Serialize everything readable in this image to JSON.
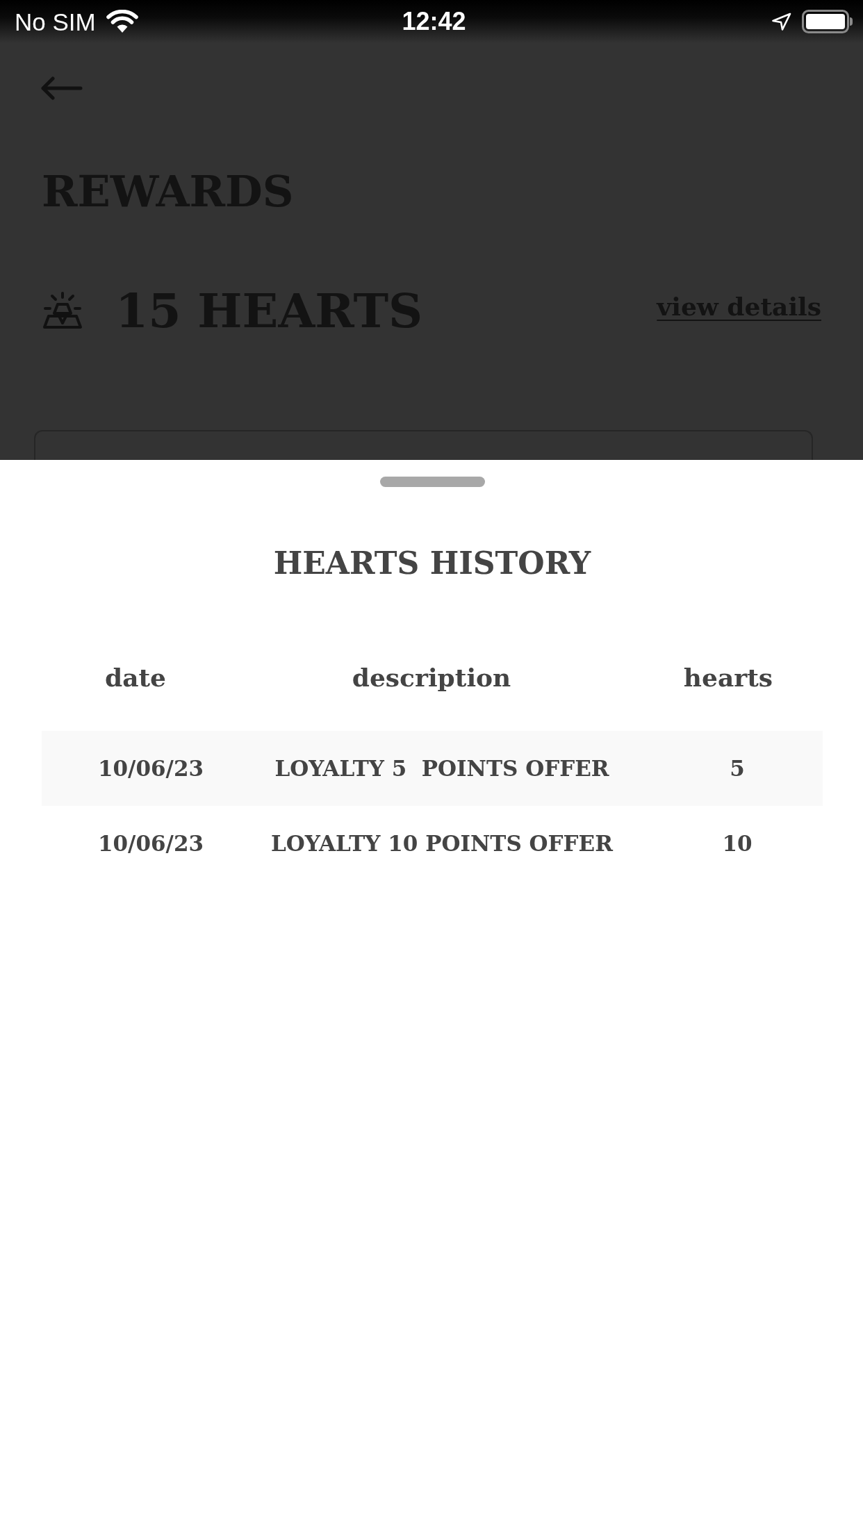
{
  "status_bar": {
    "carrier": "No SIM",
    "time": "12:42"
  },
  "page": {
    "title": "REWARDS",
    "balance": "15 HEARTS",
    "details_link": "view details"
  },
  "sheet": {
    "title": "HEARTS HISTORY",
    "table": {
      "columns": [
        "date",
        "description",
        "hearts"
      ],
      "rows": [
        {
          "date": "10/06/23",
          "description": "LOYALTY 5  POINTS OFFER",
          "hearts": "5"
        },
        {
          "date": "10/06/23",
          "description": "LOYALTY 10 POINTS OFFER",
          "hearts": "10"
        }
      ]
    }
  }
}
